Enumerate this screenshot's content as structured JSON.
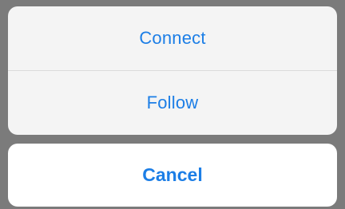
{
  "action_sheet": {
    "actions": [
      {
        "label": "Connect"
      },
      {
        "label": "Follow"
      }
    ],
    "cancel_label": "Cancel"
  },
  "colors": {
    "accent": "#1c7ee6",
    "backdrop": "#7b7b7b",
    "group_background": "#f4f4f4",
    "cancel_background": "#ffffff"
  }
}
